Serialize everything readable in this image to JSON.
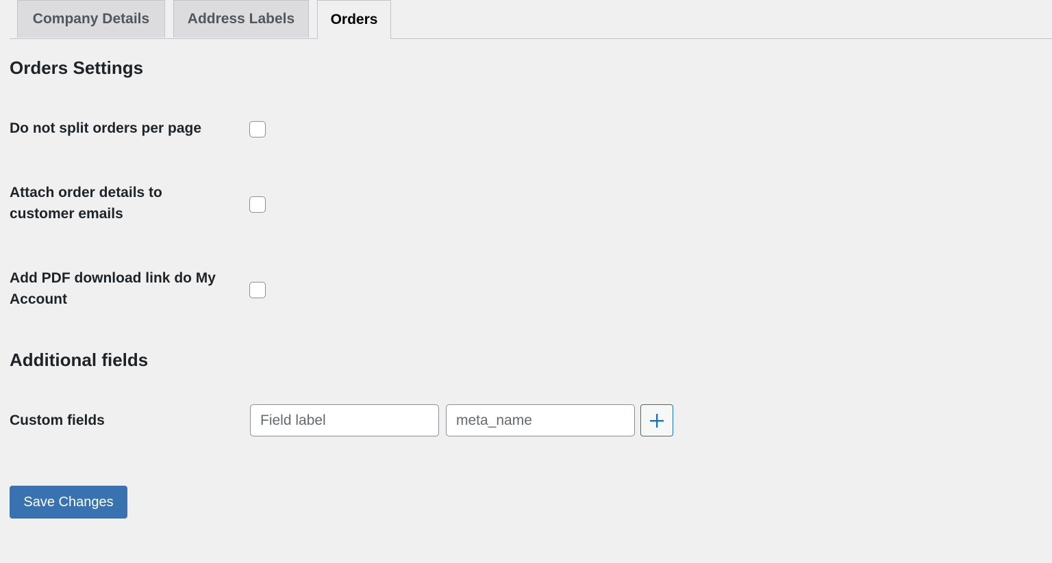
{
  "tabs": [
    {
      "label": "Company Details",
      "active": false
    },
    {
      "label": "Address Labels",
      "active": false
    },
    {
      "label": "Orders",
      "active": true
    }
  ],
  "orders_settings": {
    "title": "Orders Settings",
    "options": [
      {
        "label": "Do not split orders per page",
        "checked": false
      },
      {
        "label": "Attach order details to customer emails",
        "checked": false
      },
      {
        "label": "Add PDF download link do My Account",
        "checked": false
      }
    ]
  },
  "additional_fields": {
    "title": "Additional fields",
    "custom_fields_label": "Custom fields",
    "field_label_placeholder": "Field label",
    "meta_name_placeholder": "meta_name",
    "add_icon": "plus-icon"
  },
  "save_label": "Save Changes"
}
